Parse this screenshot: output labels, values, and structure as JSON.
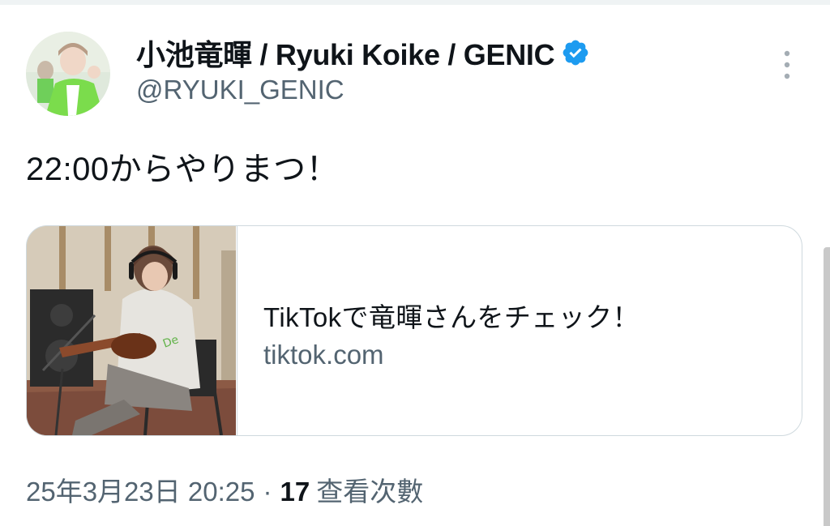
{
  "tweet": {
    "author": {
      "display_name": "小池竜暉 / Ryuki Koike / GENIC",
      "handle": "@RYUKI_GENIC",
      "verified": true
    },
    "text": "22:00からやりまつ！",
    "card": {
      "title": "TikTokで竜暉さんをチェック！",
      "domain": "tiktok.com"
    },
    "timestamp": "25年3月23日 20:25",
    "separator": "·",
    "views_count": "17",
    "views_label": "查看次數"
  },
  "colors": {
    "primary_text": "#0f1419",
    "secondary_text": "#536471",
    "verified_badge": "#1d9bf0",
    "card_border": "#cfd9de"
  },
  "icons": {
    "verified": "verified-badge-icon",
    "more": "more-vertical-icon"
  }
}
